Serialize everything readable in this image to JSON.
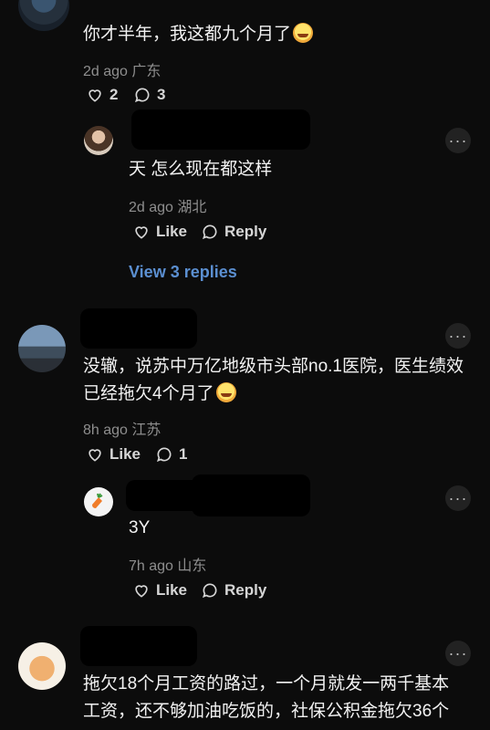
{
  "comments": [
    {
      "text": "你才半年，我这都九个月了",
      "emoji": "crying-face-icon",
      "time": "2d ago",
      "location": "广东",
      "likes": "2",
      "replies_count": "3",
      "reply": {
        "text": "天 怎么现在都这样",
        "time": "2d ago",
        "location": "湖北",
        "like_label": "Like",
        "reply_label": "Reply"
      },
      "view_replies": "View 3 replies"
    },
    {
      "text_line1": "没辙，说苏中万亿地级市头部no.1医院，医生绩效",
      "text_line2": "已经拖欠4个月了",
      "emoji": "crying-face-icon",
      "time": "8h ago",
      "location": "江苏",
      "like_label": "Like",
      "replies_count": "1",
      "reply": {
        "text": "3Y",
        "time": "7h ago",
        "location": "山东",
        "like_label": "Like",
        "reply_label": "Reply"
      }
    },
    {
      "text_line1": "拖欠18个月工资的路过，一个月就发一两千基本",
      "text_line2": "工资，还不够加油吃饭的，社保公积金拖欠36个"
    }
  ],
  "colors": {
    "background": "#0c0c0c",
    "link": "#5b8fd1",
    "meta": "#8e8e8e"
  }
}
